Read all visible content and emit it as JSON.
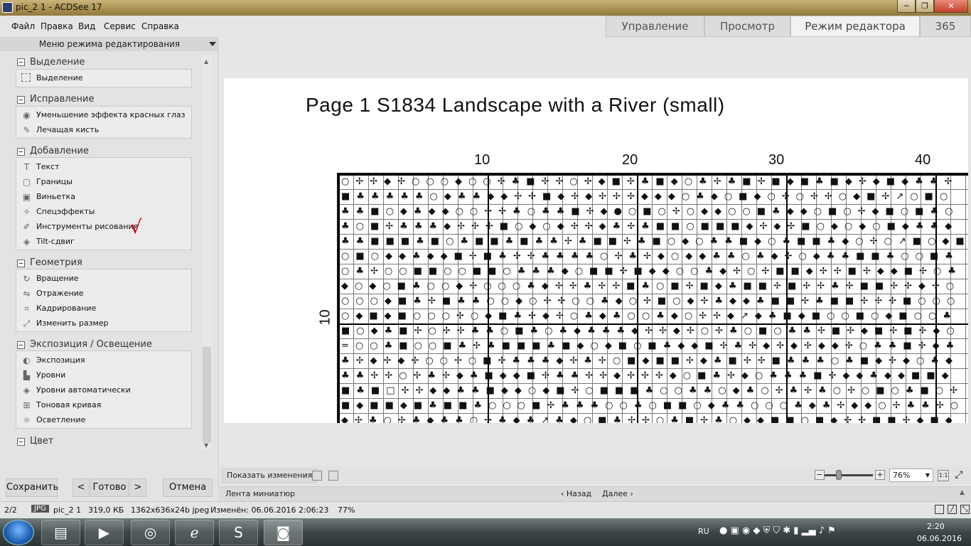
{
  "window": {
    "title": "pic_2 1 - ACDSee 17",
    "minimize": "─",
    "maximize": "❐",
    "close": "✕"
  },
  "menu": [
    "Файл",
    "Правка",
    "Вид",
    "Сервис",
    "Справка"
  ],
  "mode_tabs": [
    "Управление",
    "Просмотр",
    "Режим редактора",
    "365"
  ],
  "panel": {
    "header": "Меню режима редактирования",
    "sections": [
      {
        "title": "Выделение",
        "items": [
          {
            "icon": "selection-icon",
            "label": "Выделение"
          }
        ]
      },
      {
        "title": "Исправление",
        "items": [
          {
            "icon": "eye-icon",
            "label": "Уменьшение эффекта красных глаз"
          },
          {
            "icon": "brush-icon",
            "label": "Лечащая кисть"
          }
        ]
      },
      {
        "title": "Добавление",
        "items": [
          {
            "icon": "text-icon",
            "label": "Текст"
          },
          {
            "icon": "border-icon",
            "label": "Границы"
          },
          {
            "icon": "vignette-icon",
            "label": "Виньетка"
          },
          {
            "icon": "magic-wand-icon",
            "label": "Спецэффекты"
          },
          {
            "icon": "drawing-tools-icon",
            "label": "Инструменты рисования"
          },
          {
            "icon": "tilt-shift-icon",
            "label": "Tilt-сдвиг"
          }
        ]
      },
      {
        "title": "Геометрия",
        "items": [
          {
            "icon": "rotate-icon",
            "label": "Вращение"
          },
          {
            "icon": "flip-icon",
            "label": "Отражение"
          },
          {
            "icon": "crop-icon",
            "label": "Кадрирование"
          },
          {
            "icon": "resize-icon",
            "label": "Изменить размер"
          }
        ]
      },
      {
        "title": "Экспозиция / Освещение",
        "items": [
          {
            "icon": "exposure-icon",
            "label": "Экспозиция"
          },
          {
            "icon": "levels-icon",
            "label": "Уровни"
          },
          {
            "icon": "auto-levels-icon",
            "label": "Уровни автоматически"
          },
          {
            "icon": "tone-curve-icon",
            "label": "Тоновая кривая"
          },
          {
            "icon": "lighting-icon",
            "label": "Осветление"
          }
        ]
      },
      {
        "title": "Цвет",
        "items": []
      }
    ],
    "buttons": {
      "save": "Сохранить",
      "prev": "<",
      "done": "Готово",
      "next": ">",
      "cancel": "Отмена"
    }
  },
  "document": {
    "title": "Page 1  S1834 Landscape with a River (small)",
    "column_numbers": [
      "10",
      "20",
      "30",
      "40"
    ],
    "row_number": "10"
  },
  "viewer": {
    "show_changes": "Показать изменения",
    "zoom_minus": "−",
    "zoom_plus": "+",
    "zoom": "76%",
    "one_to_one": "1:1"
  },
  "filmstrip": {
    "label": "Лента миниатюр",
    "back": "‹ Назад",
    "forward": "Далее ›",
    "expand": "▲"
  },
  "status": {
    "position": "2/2",
    "format": "JPG",
    "filename": "pic_2 1",
    "size": "319,0 КБ",
    "dimensions": "1362x636x24b jpeg",
    "modified": "Изменён: 06.06.2016 2:06:23",
    "zoom": "77%"
  },
  "taskbar": {
    "language": "RU",
    "time": "2:20",
    "date": "06.06.2016"
  }
}
